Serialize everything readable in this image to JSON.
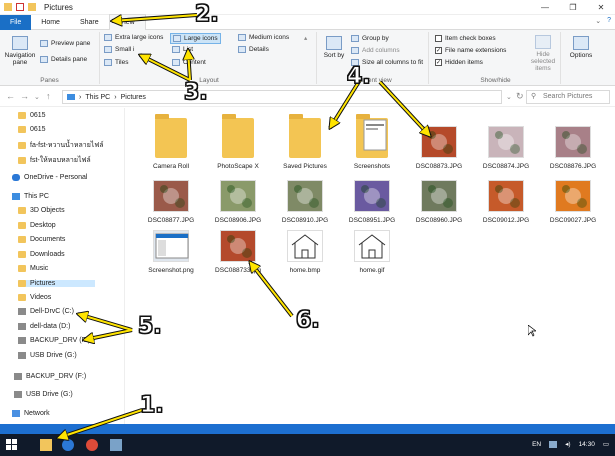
{
  "window": {
    "title": "Pictures"
  },
  "tabs": [
    "File",
    "Home",
    "Share",
    "View"
  ],
  "ribbon": {
    "panes": {
      "navigation_pane": "Navigation pane",
      "preview_pane": "Preview pane",
      "details_pane": "Details pane",
      "label": "Panes"
    },
    "layout": {
      "extra_large": "Extra large icons",
      "large": "Large icons",
      "medium": "Medium icons",
      "small": "Small i",
      "list": "List",
      "details": "Details",
      "tiles": "Tiles",
      "content": "Content",
      "label": "Layout"
    },
    "current_view": {
      "sort_by": "Sort by",
      "group_by": "Group by",
      "add_columns": "Add columns",
      "size_columns": "Size all columns to fit",
      "label": "Current view"
    },
    "show_hide": {
      "item_check": "Item check boxes",
      "extensions": "File name extensions",
      "hidden": "Hidden items",
      "hide_selected": "Hide selected items",
      "label": "Show/hide"
    },
    "options": "Options"
  },
  "address": {
    "path": [
      "This PC",
      "Pictures"
    ],
    "search_placeholder": "Search Pictures"
  },
  "sidebar": [
    {
      "label": "0615",
      "icon": "folder"
    },
    {
      "label": "0615",
      "icon": "folder"
    },
    {
      "label": "fa-fst-หวานน้ำหลายไฟล์",
      "icon": "folder"
    },
    {
      "label": "fst-ให้หอบหลายไฟล์",
      "icon": "folder"
    },
    {
      "label": "OneDrive - Personal",
      "icon": "cloud"
    },
    {
      "label": "This PC",
      "icon": "pc"
    },
    {
      "label": "3D Objects",
      "icon": "folder"
    },
    {
      "label": "Desktop",
      "icon": "folder"
    },
    {
      "label": "Documents",
      "icon": "folder"
    },
    {
      "label": "Downloads",
      "icon": "folder"
    },
    {
      "label": "Music",
      "icon": "folder"
    },
    {
      "label": "Pictures",
      "icon": "folder"
    },
    {
      "label": "Videos",
      "icon": "folder"
    },
    {
      "label": "Dell-DrvC (C:)",
      "icon": "drive"
    },
    {
      "label": "dell-data (D:)",
      "icon": "drive"
    },
    {
      "label": "BACKUP_DRV (F:)",
      "icon": "drive"
    },
    {
      "label": "USB Drive (G:)",
      "icon": "drive"
    },
    {
      "label": "BACKUP_DRV (F:)",
      "icon": "drive"
    },
    {
      "label": "USB Drive (G:)",
      "icon": "drive"
    },
    {
      "label": "Network",
      "icon": "network"
    }
  ],
  "files": [
    {
      "name": "Camera Roll",
      "kind": "folder"
    },
    {
      "name": "PhotoScape X",
      "kind": "folder"
    },
    {
      "name": "Saved Pictures",
      "kind": "folder"
    },
    {
      "name": "Screenshots",
      "kind": "folder"
    },
    {
      "name": "DSC08873.JPG",
      "kind": "photo",
      "color": "#b54a2a"
    },
    {
      "name": "DSC08874.JPG",
      "kind": "photo",
      "color": "#c9b4ba"
    },
    {
      "name": "DSC08876.JPG",
      "kind": "photo",
      "color": "#a88088"
    },
    {
      "name": "DSC08877.JPG",
      "kind": "photo",
      "color": "#9a5a4a"
    },
    {
      "name": "DSC08906.JPG",
      "kind": "photo",
      "color": "#8a9a6a"
    },
    {
      "name": "DSC08910.JPG",
      "kind": "photo",
      "color": "#7f8a66"
    },
    {
      "name": "DSC08951.JPG",
      "kind": "photo",
      "color": "#6a5aa0"
    },
    {
      "name": "DSC08960.JPG",
      "kind": "photo",
      "color": "#6f7a5e"
    },
    {
      "name": "DSC09012.JPG",
      "kind": "photo",
      "color": "#c65a2a"
    },
    {
      "name": "DSC09027.JPG",
      "kind": "photo",
      "color": "#e07a20"
    },
    {
      "name": "Screenshot.png",
      "kind": "screenshot",
      "color": "#dfe6ee"
    },
    {
      "name": "DSC088733.jpg",
      "kind": "photo",
      "color": "#b44a2c"
    },
    {
      "name": "home.bmp",
      "kind": "drawing",
      "color": "#ffffff"
    },
    {
      "name": "home.gif",
      "kind": "drawing",
      "color": "#ffffff"
    }
  ],
  "taskbar": {
    "language": "EN",
    "time": "14:30"
  },
  "annotations": [
    "1.",
    "2.",
    "3.",
    "4.",
    "5.",
    "6."
  ]
}
